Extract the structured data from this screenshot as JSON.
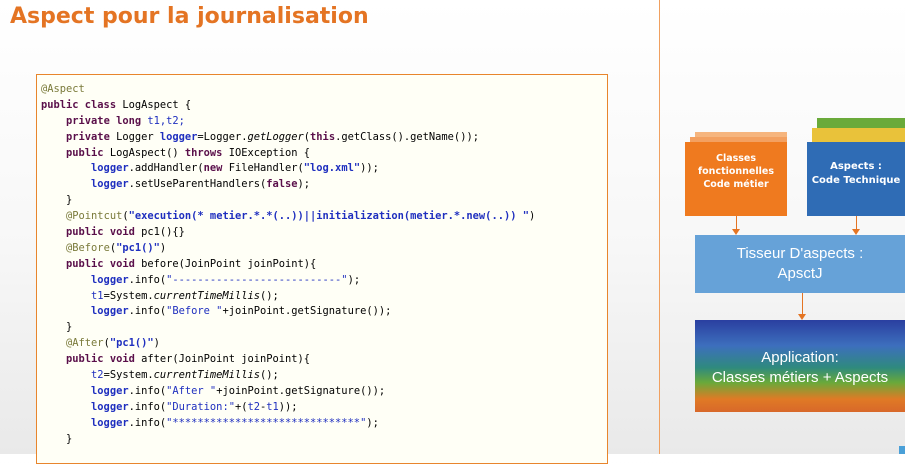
{
  "slide": {
    "title": "Aspect pour la journalisation"
  },
  "code": {
    "lines": [
      {
        "indent": "",
        "parts": [
          {
            "t": "@Aspect",
            "c": "ann"
          }
        ]
      },
      {
        "indent": "",
        "parts": [
          {
            "t": "public class",
            "c": "kw"
          },
          {
            "t": " LogAspect {",
            "c": ""
          }
        ]
      },
      {
        "indent": "    ",
        "parts": [
          {
            "t": "private long",
            "c": "kw"
          },
          {
            "t": " t1,t2;",
            "c": "str"
          }
        ]
      },
      {
        "indent": "    ",
        "parts": [
          {
            "t": "private",
            "c": "kw"
          },
          {
            "t": " Logger ",
            "c": ""
          },
          {
            "t": "logger",
            "c": "str bd"
          },
          {
            "t": "=Logger.",
            "c": ""
          },
          {
            "t": "getLogger",
            "c": "it"
          },
          {
            "t": "(",
            "c": ""
          },
          {
            "t": "this",
            "c": "kw"
          },
          {
            "t": ".getClass().getName());",
            "c": ""
          }
        ]
      },
      {
        "indent": "    ",
        "parts": [
          {
            "t": "public",
            "c": "kw"
          },
          {
            "t": " LogAspect() ",
            "c": ""
          },
          {
            "t": "throws",
            "c": "kw"
          },
          {
            "t": " IOException {",
            "c": ""
          }
        ]
      },
      {
        "indent": "        ",
        "parts": [
          {
            "t": "logger",
            "c": "str bd"
          },
          {
            "t": ".addHandler(",
            "c": ""
          },
          {
            "t": "new",
            "c": "kw"
          },
          {
            "t": " FileHandler(",
            "c": ""
          },
          {
            "t": "\"log.xml\"",
            "c": "str bd"
          },
          {
            "t": "));",
            "c": ""
          }
        ]
      },
      {
        "indent": "        ",
        "parts": [
          {
            "t": "logger",
            "c": "str bd"
          },
          {
            "t": ".setUseParentHandlers(",
            "c": ""
          },
          {
            "t": "false",
            "c": "kw"
          },
          {
            "t": ");",
            "c": ""
          }
        ]
      },
      {
        "indent": "    ",
        "parts": [
          {
            "t": "}",
            "c": ""
          }
        ]
      },
      {
        "indent": "    ",
        "parts": [
          {
            "t": "@Pointcut",
            "c": "ann"
          },
          {
            "t": "(",
            "c": ""
          },
          {
            "t": "\"execution(* metier.*.*(..))||initialization(metier.*.new(..)) \"",
            "c": "str bd"
          },
          {
            "t": ")",
            "c": ""
          }
        ]
      },
      {
        "indent": "    ",
        "parts": [
          {
            "t": "public void",
            "c": "kw"
          },
          {
            "t": " pc1(){}",
            "c": ""
          }
        ]
      },
      {
        "indent": "    ",
        "parts": [
          {
            "t": "@Before",
            "c": "ann"
          },
          {
            "t": "(",
            "c": ""
          },
          {
            "t": "\"pc1()\"",
            "c": "str bd"
          },
          {
            "t": ")",
            "c": ""
          }
        ]
      },
      {
        "indent": "    ",
        "parts": [
          {
            "t": "public void",
            "c": "kw"
          },
          {
            "t": " before(JoinPoint joinPoint){",
            "c": ""
          }
        ]
      },
      {
        "indent": "        ",
        "parts": [
          {
            "t": "logger",
            "c": "str bd"
          },
          {
            "t": ".info(",
            "c": ""
          },
          {
            "t": "\"---------------------------\"",
            "c": "str"
          },
          {
            "t": ");",
            "c": ""
          }
        ]
      },
      {
        "indent": "        ",
        "parts": [
          {
            "t": "t1",
            "c": "str"
          },
          {
            "t": "=System.",
            "c": ""
          },
          {
            "t": "currentTimeMillis",
            "c": "it"
          },
          {
            "t": "();",
            "c": ""
          }
        ]
      },
      {
        "indent": "        ",
        "parts": [
          {
            "t": "logger",
            "c": "str bd"
          },
          {
            "t": ".info(",
            "c": ""
          },
          {
            "t": "\"Before \"",
            "c": "str"
          },
          {
            "t": "+joinPoint.getSignature());",
            "c": ""
          }
        ]
      },
      {
        "indent": "    ",
        "parts": [
          {
            "t": "}",
            "c": ""
          }
        ]
      },
      {
        "indent": "    ",
        "parts": [
          {
            "t": "@After",
            "c": "ann"
          },
          {
            "t": "(",
            "c": ""
          },
          {
            "t": "\"pc1()\"",
            "c": "str bd"
          },
          {
            "t": ")",
            "c": ""
          }
        ]
      },
      {
        "indent": "    ",
        "parts": [
          {
            "t": "public void",
            "c": "kw"
          },
          {
            "t": " after(JoinPoint joinPoint){",
            "c": ""
          }
        ]
      },
      {
        "indent": "        ",
        "parts": [
          {
            "t": "t2",
            "c": "str"
          },
          {
            "t": "=System.",
            "c": ""
          },
          {
            "t": "currentTimeMillis",
            "c": "it"
          },
          {
            "t": "();",
            "c": ""
          }
        ]
      },
      {
        "indent": "        ",
        "parts": [
          {
            "t": "logger",
            "c": "str bd"
          },
          {
            "t": ".info(",
            "c": ""
          },
          {
            "t": "\"After \"",
            "c": "str"
          },
          {
            "t": "+joinPoint.getSignature());",
            "c": ""
          }
        ]
      },
      {
        "indent": "        ",
        "parts": [
          {
            "t": "logger",
            "c": "str bd"
          },
          {
            "t": ".info(",
            "c": ""
          },
          {
            "t": "\"Duration:\"",
            "c": "str"
          },
          {
            "t": "+(",
            "c": ""
          },
          {
            "t": "t2",
            "c": "str"
          },
          {
            "t": "-",
            "c": ""
          },
          {
            "t": "t1",
            "c": "str"
          },
          {
            "t": "));",
            "c": ""
          }
        ]
      },
      {
        "indent": "        ",
        "parts": [
          {
            "t": "logger",
            "c": "str bd"
          },
          {
            "t": ".info(",
            "c": ""
          },
          {
            "t": "\"******************************\"",
            "c": "str"
          },
          {
            "t": ");",
            "c": ""
          }
        ]
      },
      {
        "indent": "    ",
        "parts": [
          {
            "t": "}",
            "c": ""
          }
        ]
      }
    ]
  },
  "diagram": {
    "classes_line1": "Classes",
    "classes_line2": "fonctionnelles",
    "classes_line3": "Code métier",
    "aspects_line1": "Aspects :",
    "aspects_line2": "Code Technique",
    "tisseur_line1": "Tisseur D'aspects :",
    "tisseur_line2": "ApsctJ",
    "app_line1": "Application:",
    "app_line2": "Classes métiers + Aspects"
  },
  "colors": {
    "title": "#e47423",
    "keyword": "#5a0f4a",
    "annotation": "#7a7a3a",
    "string": "#1f2fbf"
  }
}
